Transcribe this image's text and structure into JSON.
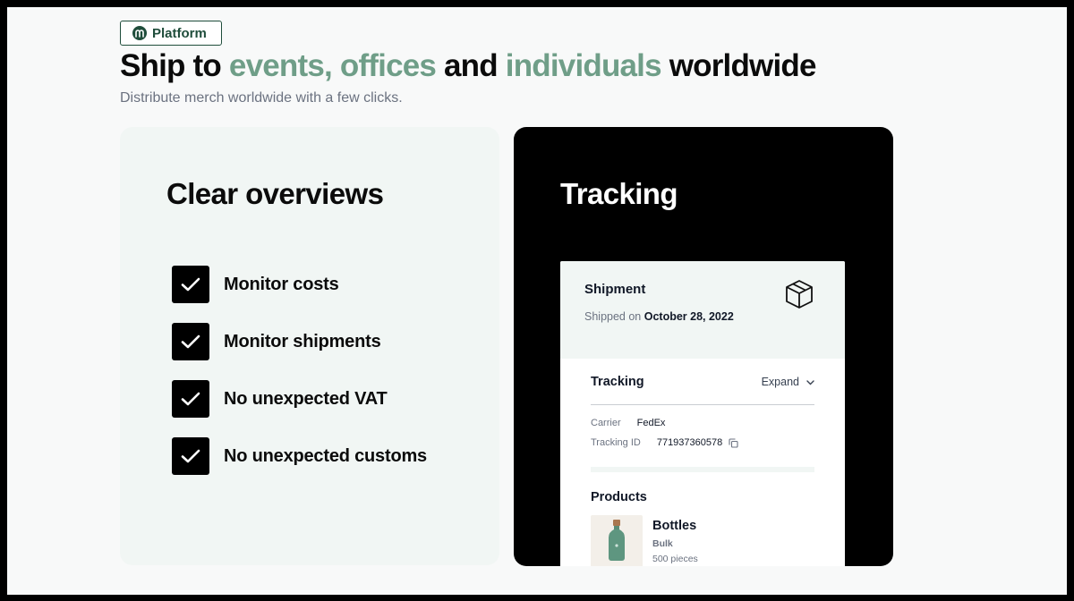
{
  "badge": {
    "label": "Platform"
  },
  "hero": {
    "title_parts": [
      "Ship to ",
      "events, offices",
      " and ",
      "individuals",
      " worldwide"
    ],
    "subtitle": "Distribute merch worldwide with a few clicks."
  },
  "overviews": {
    "title": "Clear overviews",
    "items": [
      "Monitor costs",
      "Monitor shipments",
      "No unexpected VAT",
      "No unexpected customs"
    ]
  },
  "tracking_card": {
    "title": "Tracking",
    "shipment": {
      "title": "Shipment",
      "shipped_prefix": "Shipped on ",
      "shipped_date": "October 28, 2022"
    },
    "tracking": {
      "title": "Tracking",
      "expand_label": "Expand",
      "carrier_label": "Carrier",
      "carrier_value": "FedEx",
      "tracking_id_label": "Tracking ID",
      "tracking_id_value": "771937360578"
    },
    "products": {
      "title": "Products",
      "items": [
        {
          "name": "Bottles",
          "variant": "Bulk",
          "quantity": "500 pieces"
        }
      ]
    }
  },
  "colors": {
    "brand_dark": "#1f4d3b",
    "accent": "#6f9e88",
    "panel_tint": "#f1f6f4"
  },
  "icons": [
    "platform-logo-icon",
    "check-icon",
    "package-box-icon",
    "chevron-down-icon",
    "copy-icon",
    "bottle-icon"
  ]
}
